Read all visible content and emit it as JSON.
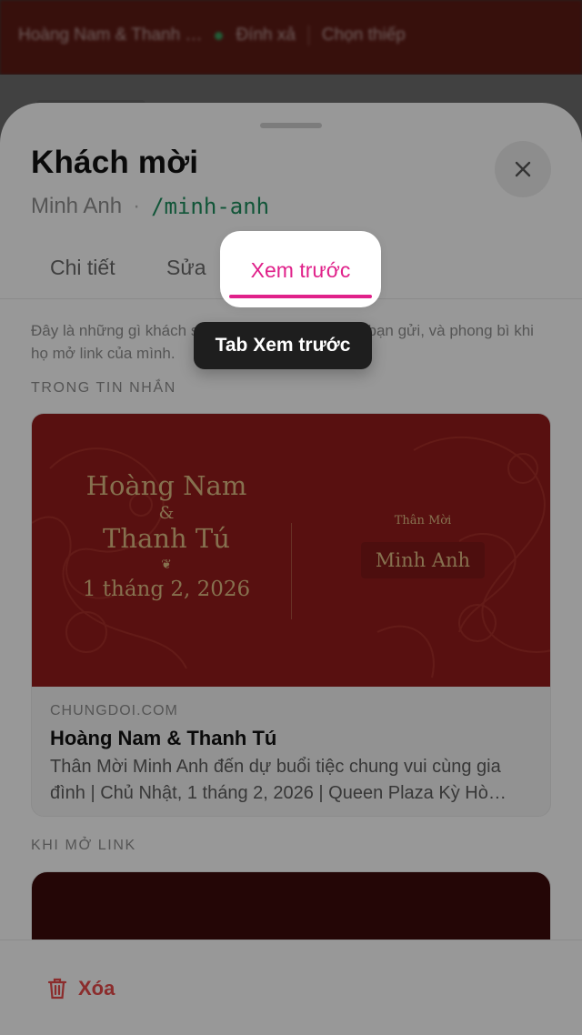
{
  "background": {
    "project_title": "Hoàng Nam & Thanh …",
    "status_link": "Đính xả",
    "action_link": "Chọn thiếp"
  },
  "sheet": {
    "title": "Khách mời",
    "guest_name": "Minh Anh",
    "separator": "·",
    "slug": "/minh-anh",
    "close_icon": "close-icon"
  },
  "tabs": [
    {
      "label": "Chi tiết"
    },
    {
      "label": "Sửa"
    },
    {
      "label": "Xem trước",
      "active": true
    }
  ],
  "tooltip": "Tab Xem trước",
  "description": "Đây là những gì khách sẽ thấy trong tin nhắn khi bạn gửi, và phong bì khi họ mở link của mình.",
  "section_message": "TRONG TIN NHẮN",
  "card": {
    "names_line1": "Hoàng Nam",
    "ampersand": "&",
    "names_line2": "Thanh Tú",
    "ornament": "❦",
    "date": "1 tháng 2, 2026",
    "invite_label": "Thân Mời",
    "guest": "Minh Anh",
    "site": "CHUNGDOI.COM",
    "link_title": "Hoàng Nam & Thanh Tú",
    "link_description": "Thân Mời Minh Anh đến dự buổi tiệc chung vui cùng gia đình | Chủ Nhật, 1 tháng 2, 2026 | Queen Plaza Kỳ Hò…"
  },
  "section_link": "KHI MỞ LINK",
  "footer": {
    "delete_label": "Xóa",
    "delete_icon": "trash-icon"
  },
  "colors": {
    "accent": "#e0218a",
    "slug": "#1c8a5b",
    "danger": "#e04848",
    "card_red": "#8e1b1b",
    "gold": "#d9b680"
  }
}
